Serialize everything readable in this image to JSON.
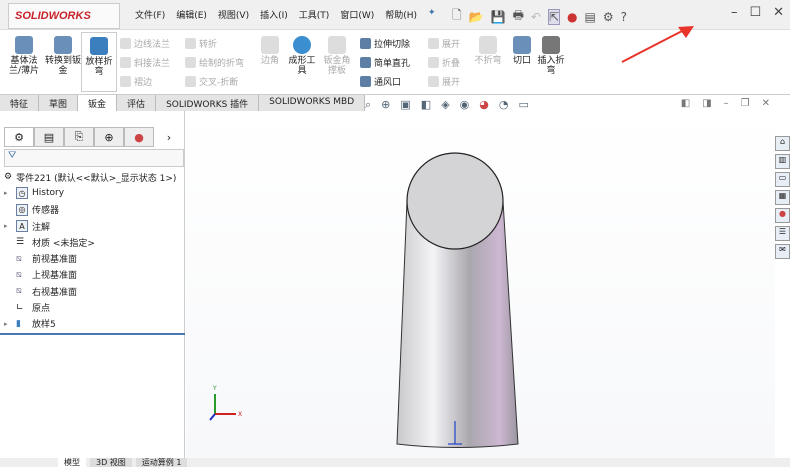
{
  "app": {
    "logo": "SOLIDWORKS"
  },
  "menu": [
    "文件(F)",
    "编辑(E)",
    "视图(V)",
    "插入(I)",
    "工具(T)",
    "窗口(W)",
    "帮助(H)"
  ],
  "ribbon": {
    "base_flange": "基体法兰/薄片",
    "convert": "转换到钣金",
    "lofted_bend": "放样折弯",
    "edge_flange": "边线法兰",
    "miter_flange": "斜接法兰",
    "hem": "褶边",
    "jog": "转折",
    "sketched_bend": "绘制的折弯",
    "cross_break": "交叉-折断",
    "corners": "边角",
    "forming_tool": "成形工具",
    "gusset": "钣金角撑板",
    "extruded_cut": "拉伸切除",
    "simple_hole": "简单直孔",
    "vent": "通风口",
    "unfold": "展开",
    "fold": "折叠",
    "flatten": "展开",
    "no_bends": "不折弯",
    "rip": "切口",
    "insert_bends": "插入折弯"
  },
  "tabs": [
    "特征",
    "草图",
    "钣金",
    "评估",
    "SOLIDWORKS 插件",
    "SOLIDWORKS MBD"
  ],
  "tree": {
    "root": "零件221 (默认<<默认>_显示状态 1>)",
    "items": [
      "History",
      "传感器",
      "注解",
      "材质 <未指定>",
      "前视基准面",
      "上视基准面",
      "右视基准面",
      "原点",
      "放样5"
    ]
  },
  "bottom_tabs": [
    "模型",
    "3D 视图",
    "运动算例 1"
  ],
  "triad": {
    "x": "X",
    "y": "Y"
  },
  "colors": {
    "accent": "#c8222a",
    "arrow": "#e8342a"
  }
}
